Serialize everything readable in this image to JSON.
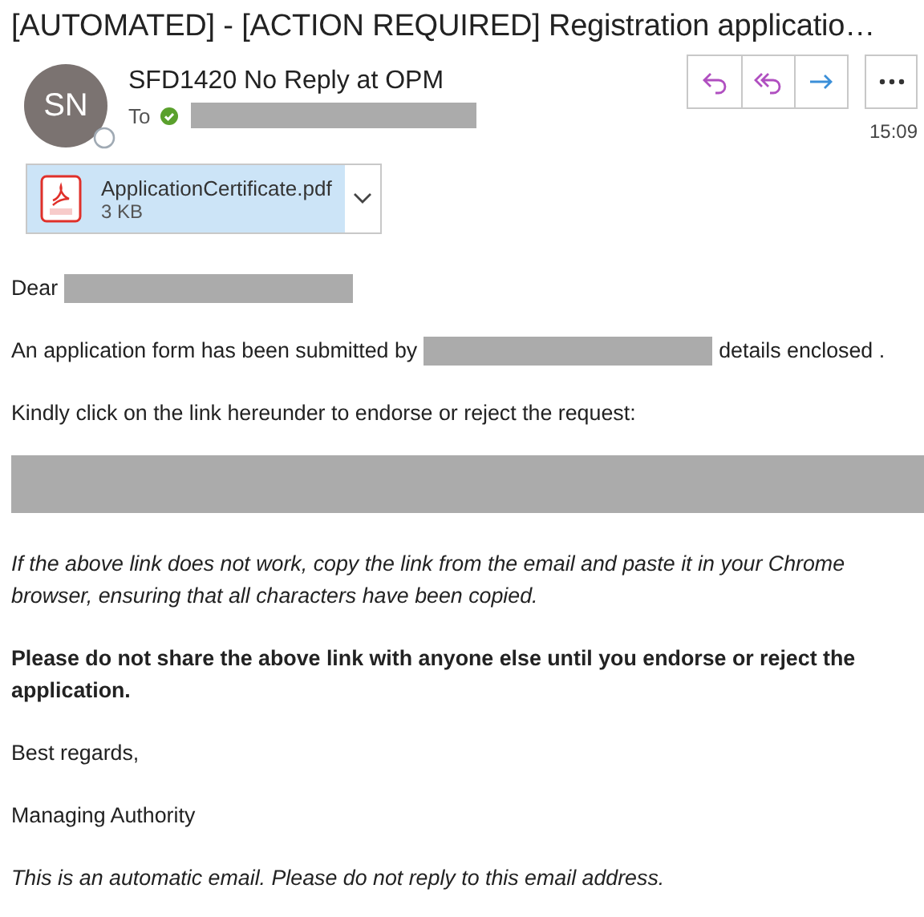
{
  "subject": "[AUTOMATED] - [ACTION REQUIRED] Registration applicatio…",
  "sender": {
    "initials": "SN",
    "name": "SFD1420 No Reply at OPM"
  },
  "to_label": "To",
  "time": "15:09",
  "attachment": {
    "name": "ApplicationCertificate.pdf",
    "size": "3 KB"
  },
  "body": [
    {
      "kind": "line",
      "parts": [
        {
          "kind": "text",
          "text": "Dear"
        },
        {
          "kind": "redacted"
        }
      ]
    },
    {
      "kind": "line",
      "parts": [
        {
          "kind": "text",
          "text": "An application form has been submitted by"
        },
        {
          "kind": "redacted"
        },
        {
          "kind": "text",
          "text": "details enclosed ."
        }
      ]
    },
    {
      "kind": "line",
      "parts": [
        {
          "kind": "text",
          "text": "Kindly click on the link hereunder to endorse or reject the request:"
        }
      ]
    },
    {
      "kind": "redacted_block"
    },
    {
      "kind": "italic",
      "text": "If the above link does not work, copy the link from the email and paste it in your Chrome browser, ensuring that all characters have been copied."
    },
    {
      "kind": "bold",
      "text": "Please do not share the above link with anyone else until you endorse or reject the application."
    },
    {
      "kind": "line",
      "parts": [
        {
          "kind": "text",
          "text": "Best regards,"
        }
      ]
    },
    {
      "kind": "line",
      "parts": [
        {
          "kind": "text",
          "text": "Managing Authority"
        }
      ]
    },
    {
      "kind": "italic",
      "text": "This is an automatic email. Please do not reply to this email address."
    }
  ]
}
